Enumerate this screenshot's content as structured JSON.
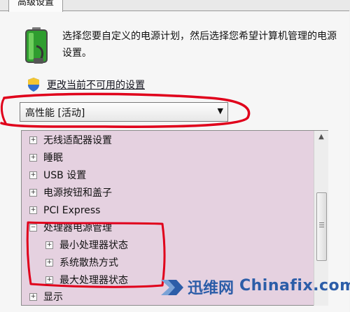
{
  "tab": {
    "label": "高级设置"
  },
  "description": "选择您要自定义的电源计划，然后选择您希望计算机管理的电源设置。",
  "change_link": "更改当前不可用的设置",
  "plan_select": {
    "value": "高性能 [活动]"
  },
  "tree": {
    "items": [
      {
        "label": "无线适配器设置",
        "expander": "+"
      },
      {
        "label": "睡眠",
        "expander": "+"
      },
      {
        "label": "USB 设置",
        "expander": "+"
      },
      {
        "label": "电源按钮和盖子",
        "expander": "+"
      },
      {
        "label": "PCI Express",
        "expander": "+"
      },
      {
        "label": "处理器电源管理",
        "expander": "−"
      },
      {
        "label": "最小处理器状态",
        "expander": "+"
      },
      {
        "label": "系统散热方式",
        "expander": "+"
      },
      {
        "label": "最大处理器状态",
        "expander": "+"
      },
      {
        "label": "显示",
        "expander": "+"
      }
    ]
  },
  "watermark": {
    "cn": "迅维网",
    "en": "Chinafix.com"
  },
  "colors": {
    "tree_bg": "#e5d1e0",
    "annotation": "#e0001b",
    "watermark": "#2c5da8"
  }
}
